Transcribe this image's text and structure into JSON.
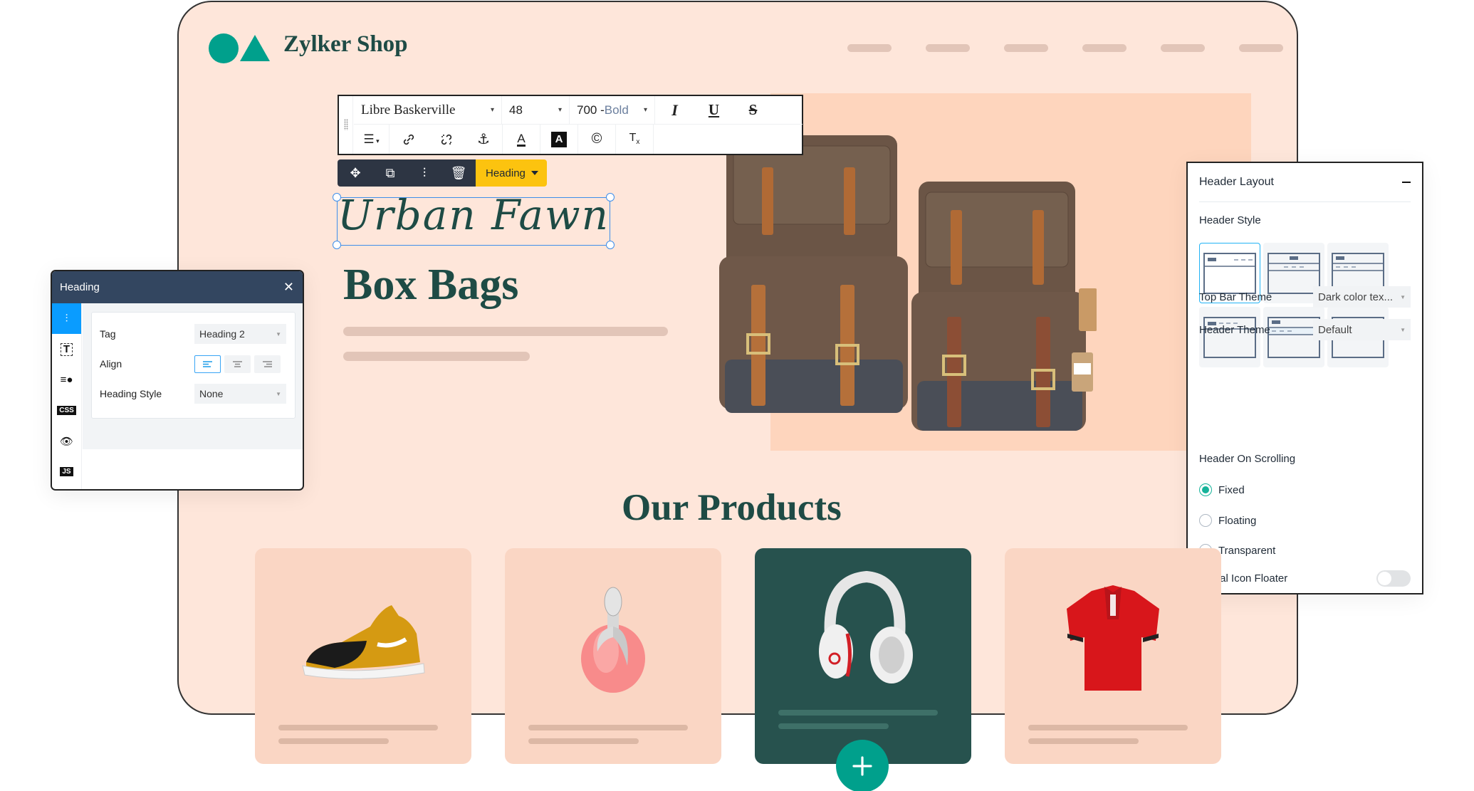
{
  "site": {
    "brand": "Zylker Shop",
    "nav_item_count": 6,
    "hero": {
      "script_heading": "Urban Fawn",
      "title": "Box Bags"
    },
    "products_title": "Our Products",
    "products": [
      {
        "name": "sneaker",
        "icon": "sneaker-image"
      },
      {
        "name": "perfume",
        "icon": "perfume-bottle-image"
      },
      {
        "name": "headphones",
        "icon": "headphones-image",
        "selected": true
      },
      {
        "name": "polo shirt",
        "icon": "polo-shirt-image"
      }
    ],
    "add_button_label": "+",
    "colors": {
      "brand": "#00a08c",
      "heading": "#1e4b45",
      "page_bg": "#fee6da",
      "card_bg": "#fad6c4",
      "card_selected_bg": "#27524e",
      "accent_yellow": "#fcc30f",
      "selection_blue": "#3d8eea"
    }
  },
  "format_toolbar": {
    "font_family": "Libre Baskerville",
    "font_size": "48",
    "font_weight_num": "700 -",
    "font_weight_name": "Bold",
    "row1_icons": [
      "italic-icon",
      "underline-icon",
      "strikethrough-icon"
    ],
    "row1_glyphs": [
      "I",
      "U",
      "S"
    ],
    "row2_icons": [
      "list-indent-icon",
      "link-icon",
      "unlink-icon",
      "anchor-icon",
      "text-color-icon",
      "highlight-color-icon",
      "copyright-icon",
      "clear-format-icon"
    ],
    "row2_glyphs": [
      "☰",
      "🔗",
      "⛓",
      "⚓",
      "A",
      "A",
      "©",
      "Tx"
    ]
  },
  "element_toolbar": {
    "icons": [
      "move-icon",
      "duplicate-icon",
      "settings-icon",
      "delete-icon"
    ],
    "glyphs": [
      "✥",
      "⧉",
      "⫶",
      "🗑"
    ],
    "element_type": "Heading"
  },
  "heading_panel": {
    "title": "Heading",
    "close_glyph": "✕",
    "side_tabs": [
      {
        "name": "settings",
        "glyph": "⫶",
        "active": true
      },
      {
        "name": "text",
        "glyph": "T"
      },
      {
        "name": "animation",
        "glyph": "≡●"
      },
      {
        "name": "css",
        "glyph": "CSS"
      },
      {
        "name": "visibility",
        "glyph": "👁"
      },
      {
        "name": "js",
        "glyph": "JS"
      }
    ],
    "fields": {
      "tag_label": "Tag",
      "tag_value": "Heading 2",
      "align_label": "Align",
      "align_options": [
        "left",
        "center",
        "right"
      ],
      "align_selected": "left",
      "style_label": "Heading Style",
      "style_value": "None"
    }
  },
  "header_layout_panel": {
    "title": "Header Layout",
    "collapse_glyph": "−",
    "header_style_label": "Header Style",
    "header_style_selected": 1,
    "header_style_count": 6,
    "top_bar_theme_label": "Top Bar Theme",
    "top_bar_theme_value": "Dark color tex...",
    "header_theme_label": "Header Theme",
    "header_theme_value": "Default",
    "scrolling_label": "Header On Scrolling",
    "scrolling_options": [
      "Fixed",
      "Floating",
      "Transparent"
    ],
    "scrolling_selected": "Fixed",
    "social_floater_label": "Social Icon Floater",
    "social_floater_on": false
  }
}
